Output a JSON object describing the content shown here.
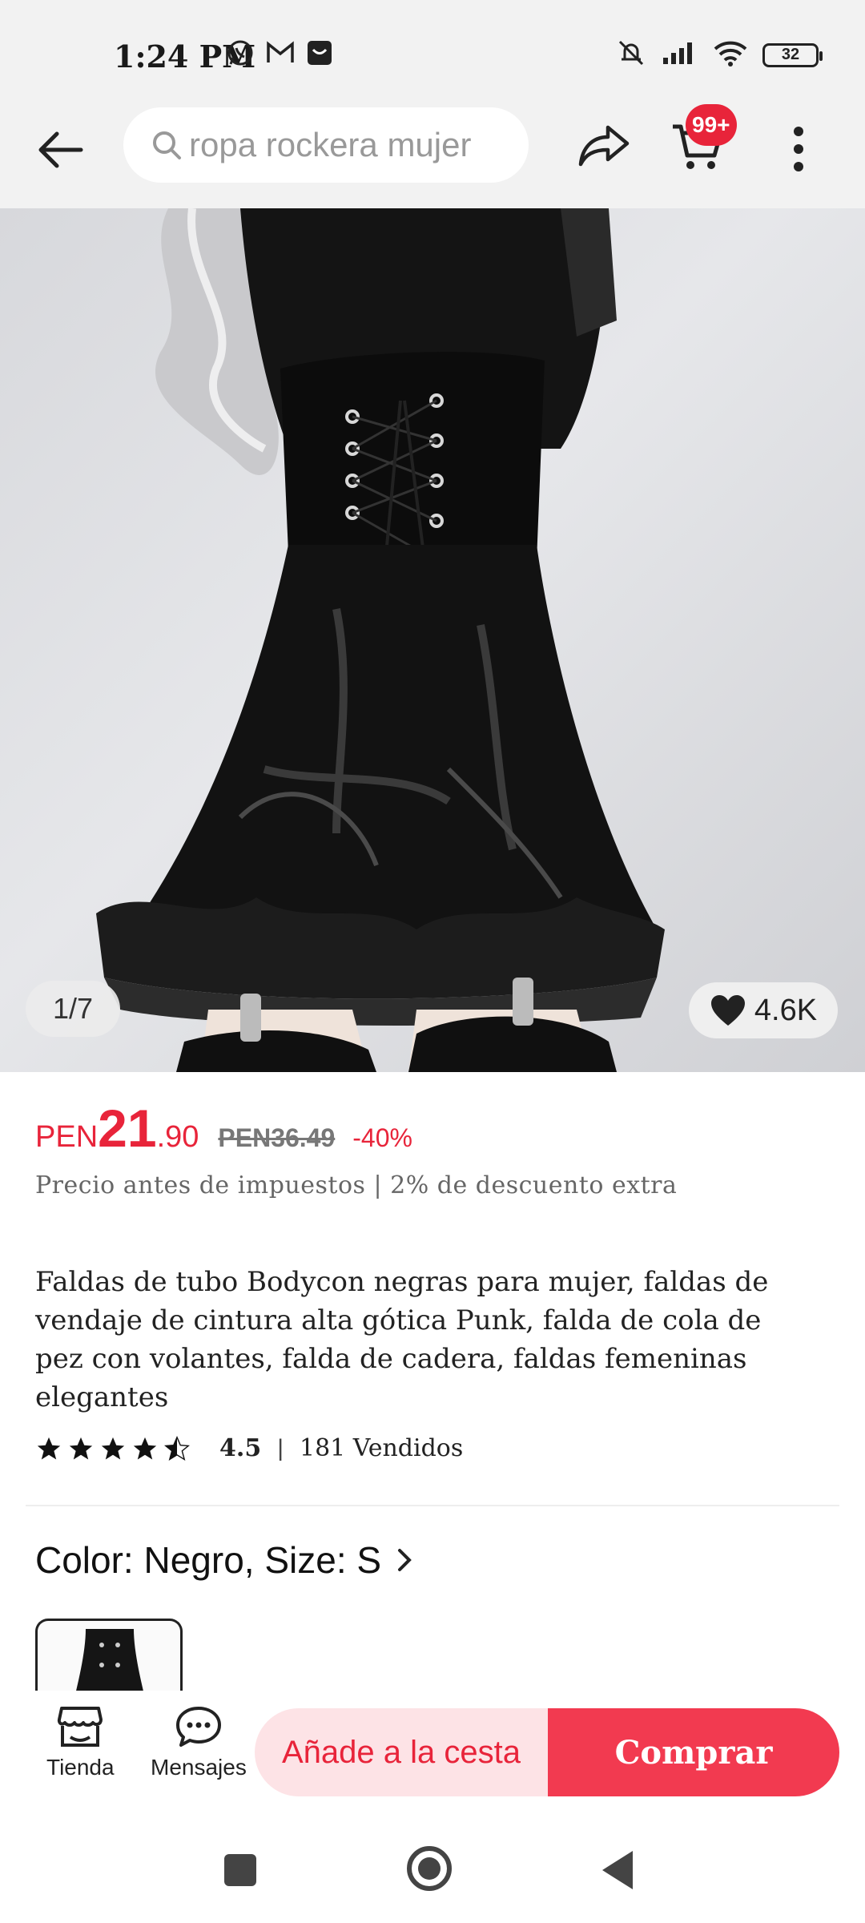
{
  "status_bar": {
    "time": "1:24 PM",
    "battery": "32",
    "icons": [
      "whatsapp-icon",
      "gmail-icon",
      "notification-icon",
      "mute-icon",
      "signal-icon",
      "wifi-icon",
      "battery-icon"
    ]
  },
  "top_bar": {
    "search_query": "ropa rockera mujer",
    "cart_badge": "99+"
  },
  "gallery": {
    "counter": "1/7",
    "likes": "4.6K"
  },
  "price": {
    "currency": "PEN",
    "integer": "21",
    "decimal": ".90",
    "original": "PEN36.49",
    "discount": "-40%",
    "note": "Precio antes de impuestos | 2% de descuento extra"
  },
  "product": {
    "title": "Faldas de tubo Bodycon negras para mujer, faldas de vendaje de cintura alta gótica Punk, falda de cola de pez con volantes, falda de cadera, faldas femeninas elegantes",
    "rating": "4.5",
    "rating_separator": "|",
    "sold": "181 Vendidos",
    "stars_filled": 4.5
  },
  "variant": {
    "label": "Color: Negro, Size: S"
  },
  "bottom_bar": {
    "store_label": "Tienda",
    "messages_label": "Mensajes",
    "add_to_cart": "Añade a la cesta",
    "buy": "Comprar"
  },
  "colors": {
    "accent": "#e8243a",
    "accent_light": "#fde3e6",
    "buy_button": "#f23a50"
  }
}
